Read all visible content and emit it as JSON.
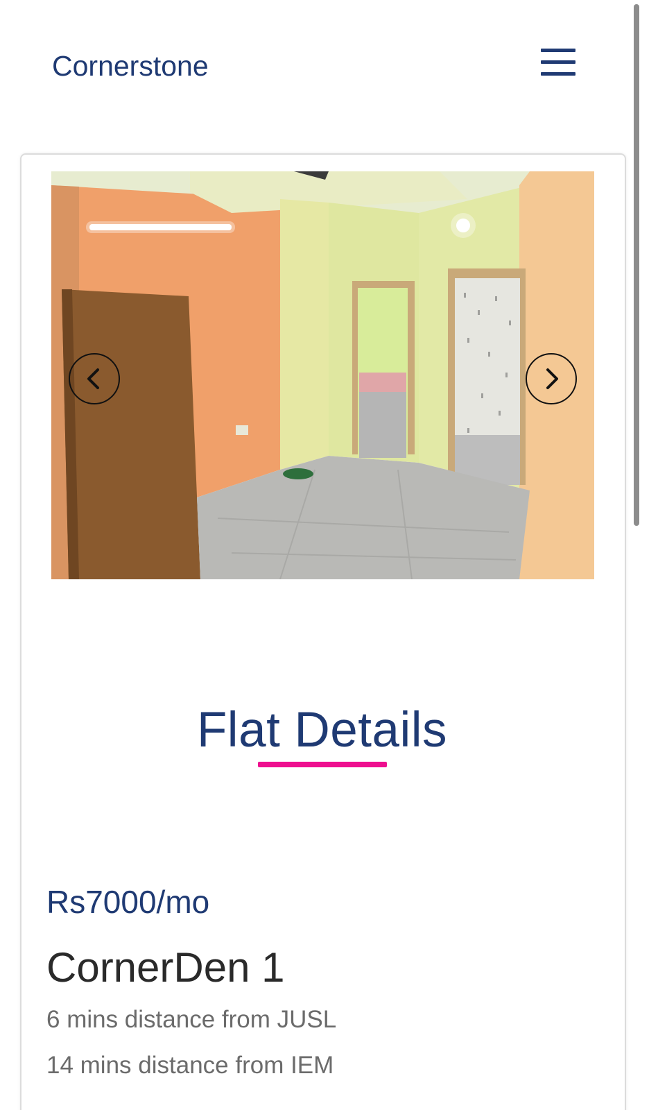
{
  "navbar": {
    "brand": "Cornerstone",
    "menu_icon": "hamburger-menu-icon"
  },
  "carousel": {
    "image_alt": "Flat interior photo",
    "prev_icon": "chevron-left-icon",
    "next_icon": "chevron-right-icon"
  },
  "details": {
    "section_title": "Flat Details",
    "price": "Rs7000/mo",
    "name": "CornerDen 1",
    "distances": [
      "6 mins distance from JUSL",
      "14 mins distance from IEM"
    ]
  },
  "colors": {
    "brand": "#1f3a73",
    "accent": "#ee0f8f",
    "muted_text": "#6b6b6b"
  }
}
